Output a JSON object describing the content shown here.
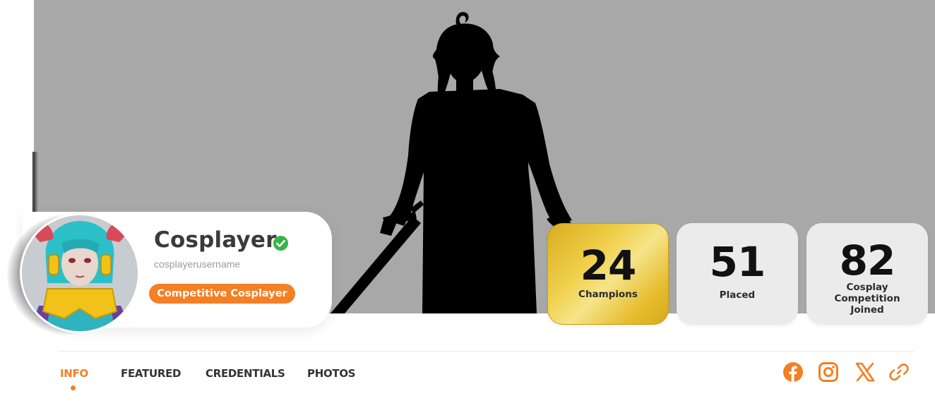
{
  "profile": {
    "name": "Cosplayer",
    "username": "cosplayerusername",
    "role": "Competitive Cosplayer",
    "avatar_icon": "avatar-photo",
    "verified_icon": "check-circle-icon"
  },
  "stats": [
    {
      "value": "24",
      "label": "Champions",
      "style": "gold"
    },
    {
      "value": "51",
      "label": "Placed",
      "style": "plain"
    },
    {
      "value": "82",
      "label": "Cosplay Competition Joined",
      "style": "plain"
    }
  ],
  "tabs": [
    {
      "label": "INFO",
      "active": true
    },
    {
      "label": "FEATURED",
      "active": false
    },
    {
      "label": "CREDENTIALS",
      "active": false
    },
    {
      "label": "PHOTOS",
      "active": false
    }
  ],
  "social_links": [
    {
      "name": "facebook-icon"
    },
    {
      "name": "instagram-icon"
    },
    {
      "name": "x-icon"
    },
    {
      "name": "link-icon"
    }
  ],
  "colors": {
    "accent": "#f47f25",
    "banner_bg": "#a8a8a8",
    "verified": "#3cb34a",
    "gold": "#e9c33a"
  }
}
